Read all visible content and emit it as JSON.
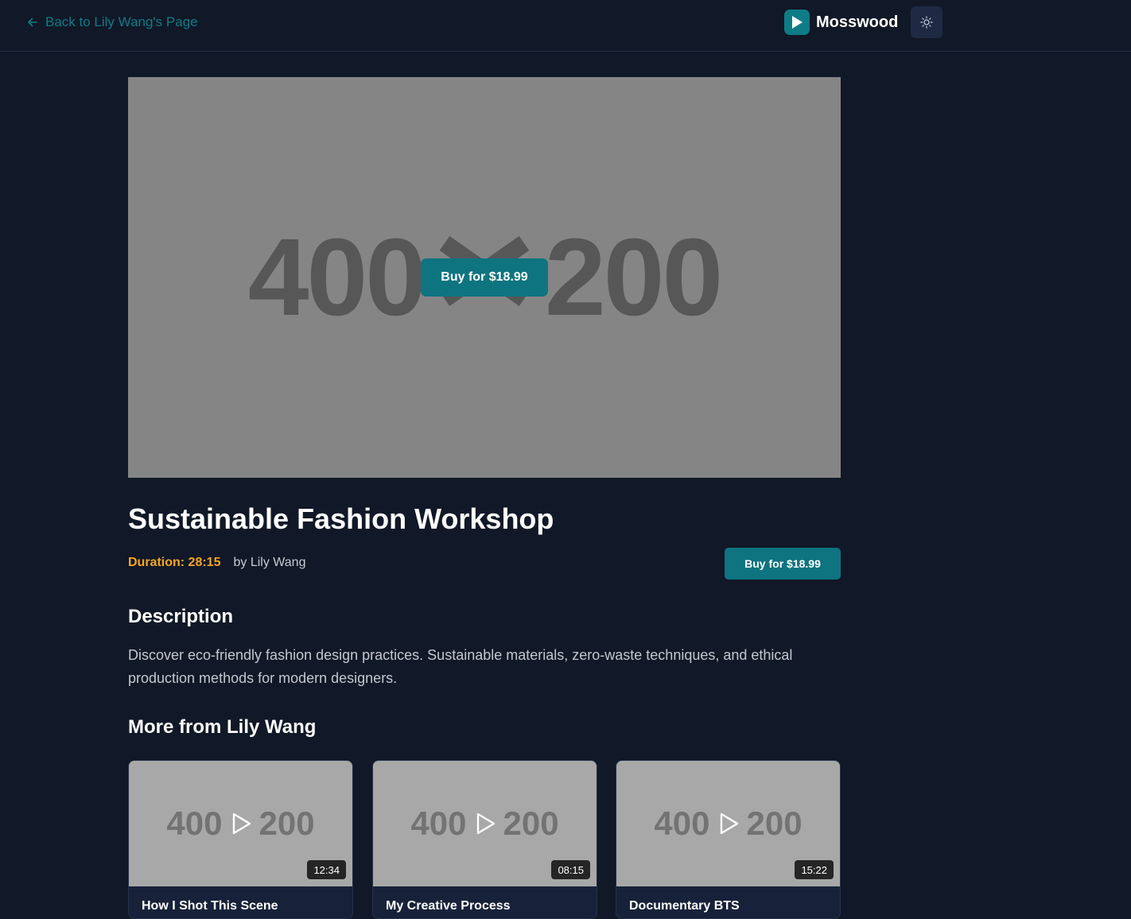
{
  "header": {
    "back_label": "Back to Lily Wang's Page",
    "brand_name": "Mosswood",
    "accent_color": "#0e7c86",
    "theme_icon": "sun-icon"
  },
  "hero": {
    "placeholder_left": "400",
    "placeholder_right": "200",
    "buy_label": "Buy for $18.99"
  },
  "video": {
    "title": "Sustainable Fashion Workshop",
    "duration": "Duration: 28:15",
    "byline": "by Lily Wang",
    "buy_label": "Buy for $18.99"
  },
  "description": {
    "heading": "Description",
    "text": "Discover eco-friendly fashion design practices. Sustainable materials, zero-waste techniques, and ethical production methods for modern designers."
  },
  "more": {
    "heading": "More from Lily Wang",
    "items": [
      {
        "placeholder_left": "400",
        "placeholder_right": "200",
        "duration": "12:34",
        "title": "How I Shot This Scene"
      },
      {
        "placeholder_left": "400",
        "placeholder_right": "200",
        "duration": "08:15",
        "title": "My Creative Process"
      },
      {
        "placeholder_left": "400",
        "placeholder_right": "200",
        "duration": "15:22",
        "title": "Documentary BTS"
      }
    ]
  }
}
